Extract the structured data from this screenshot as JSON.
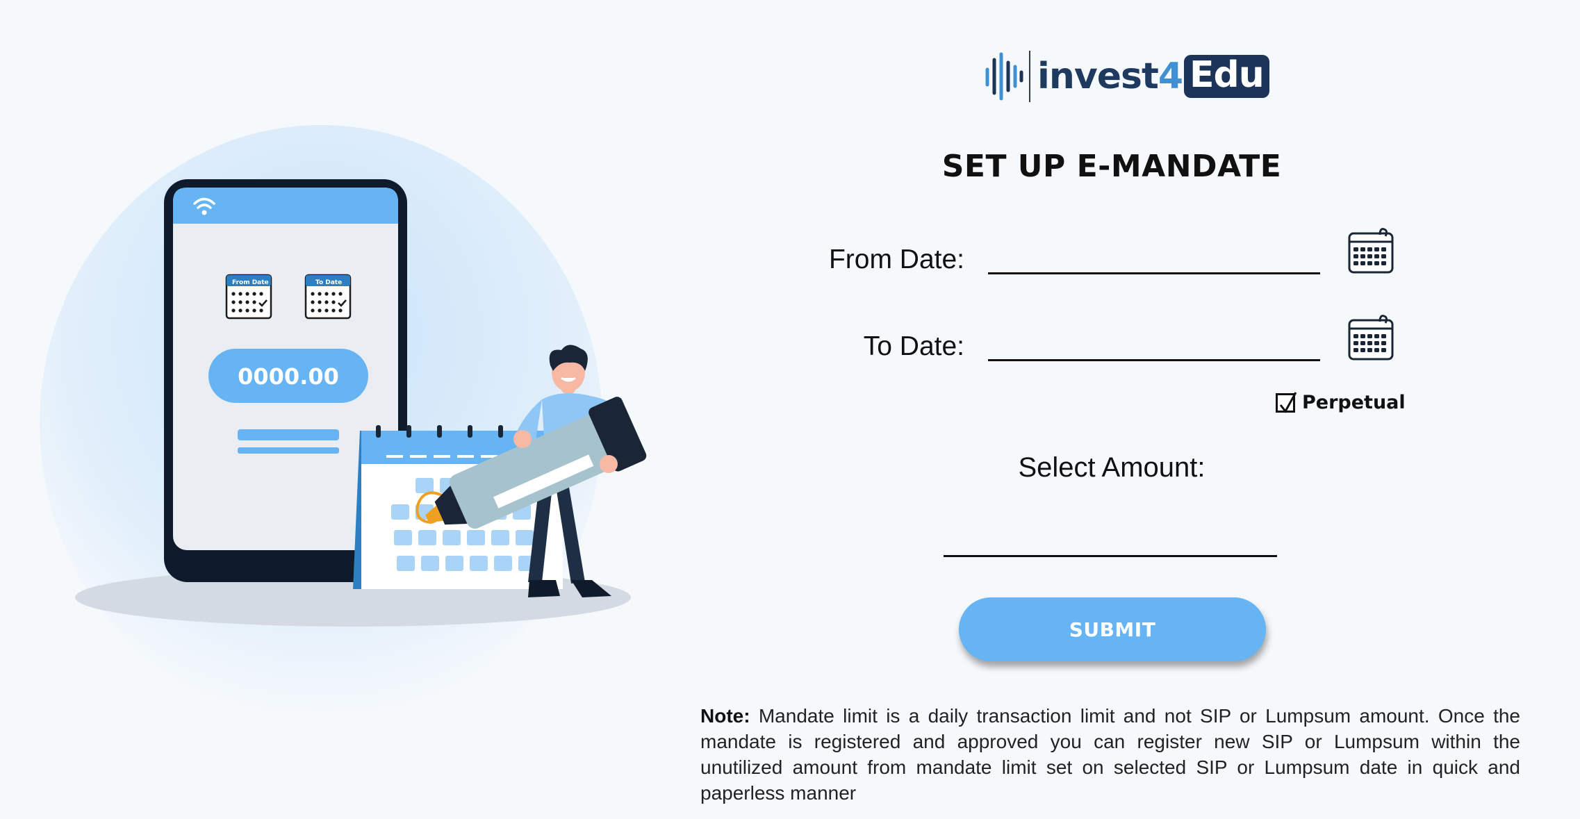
{
  "brand": {
    "name_prefix": "invest",
    "name_digit": "4",
    "name_suffix": "Edu"
  },
  "illustration": {
    "phone_amount": "0000.00",
    "from_date_caption": "From Date",
    "to_date_caption": "To Date"
  },
  "form": {
    "title": "SET UP E-MANDATE",
    "from_date_label": "From Date:",
    "to_date_label": "To Date:",
    "perpetual_label": "Perpetual",
    "perpetual_checked": true,
    "amount_label": "Select Amount:",
    "submit_label": "SUBMIT"
  },
  "note": {
    "label": "Note:",
    "text": "Mandate limit is a daily transaction limit and not SIP or Lumpsum amount. Once the mandate is registered and approved you can register new SIP or Lumpsum within the unutilized amount from mandate limit set on selected SIP or Lumpsum date in quick and paperless manner"
  },
  "colors": {
    "background": "#f6f9fc",
    "accent_blue": "#66b4f3",
    "brand_navy": "#1b3457",
    "text": "#111111"
  },
  "icons": [
    "wifi-icon",
    "calendar-icon",
    "check-icon"
  ]
}
